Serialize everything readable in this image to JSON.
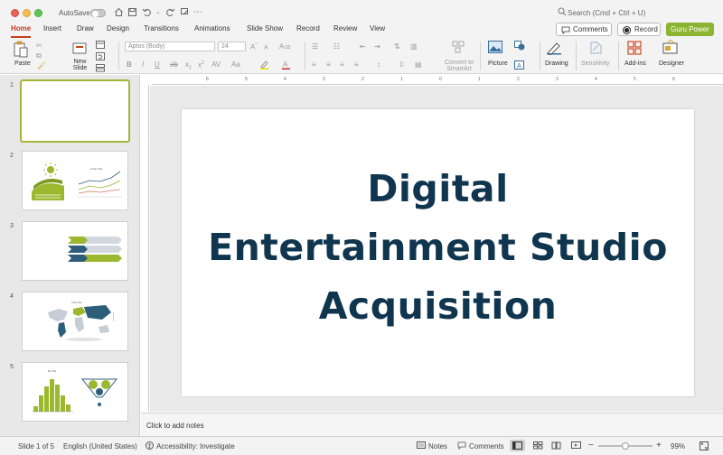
{
  "titlebar": {
    "autosave_label": "AutoSave",
    "search_placeholder": "Search (Cmd + Ctrl + U)"
  },
  "tabs": {
    "items": [
      "Home",
      "Insert",
      "Draw",
      "Design",
      "Transitions",
      "Animations",
      "Slide Show",
      "Record",
      "Review",
      "View"
    ],
    "active": "Home",
    "comments_label": "Comments",
    "record_label": "Record",
    "guru_label": "Guru Power"
  },
  "ribbon": {
    "paste_label": "Paste",
    "new_slide_label": "New Slide",
    "font_name_placeholder": "Aptos (Body)",
    "font_size_value": "24",
    "convert_smartart_label": "Convert to SmartArt",
    "picture_label": "Picture",
    "drawing_label": "Drawing",
    "sensitivity_label": "Sensitivity",
    "addins_label": "Add-ins",
    "designer_label": "Designer"
  },
  "slides": {
    "numbers": [
      "1",
      "2",
      "3",
      "4",
      "5"
    ],
    "selected": 1,
    "thumb4_title": "Chart Title"
  },
  "main_slide": {
    "title_line1": "Digital",
    "title_line2": "Entertainment Studio",
    "title_line3": "Acquisition",
    "title_color": "#10354f"
  },
  "ruler": {
    "numbers": [
      "6",
      "5",
      "4",
      "3",
      "2",
      "1",
      "0",
      "1",
      "2",
      "3",
      "4",
      "5",
      "6"
    ]
  },
  "notes": {
    "placeholder": "Click to add notes"
  },
  "status": {
    "slide_position": "Slide 1 of 5",
    "language": "English (United States)",
    "accessibility": "Accessibility: Investigate",
    "notes_label": "Notes",
    "comments_label": "Comments",
    "zoom_percent": "99%"
  },
  "colors": {
    "accent_red": "#c43e1c",
    "guru_green": "#8bb431",
    "thumb_green": "#9bb82e",
    "thumb_navy": "#2d5d7b"
  }
}
